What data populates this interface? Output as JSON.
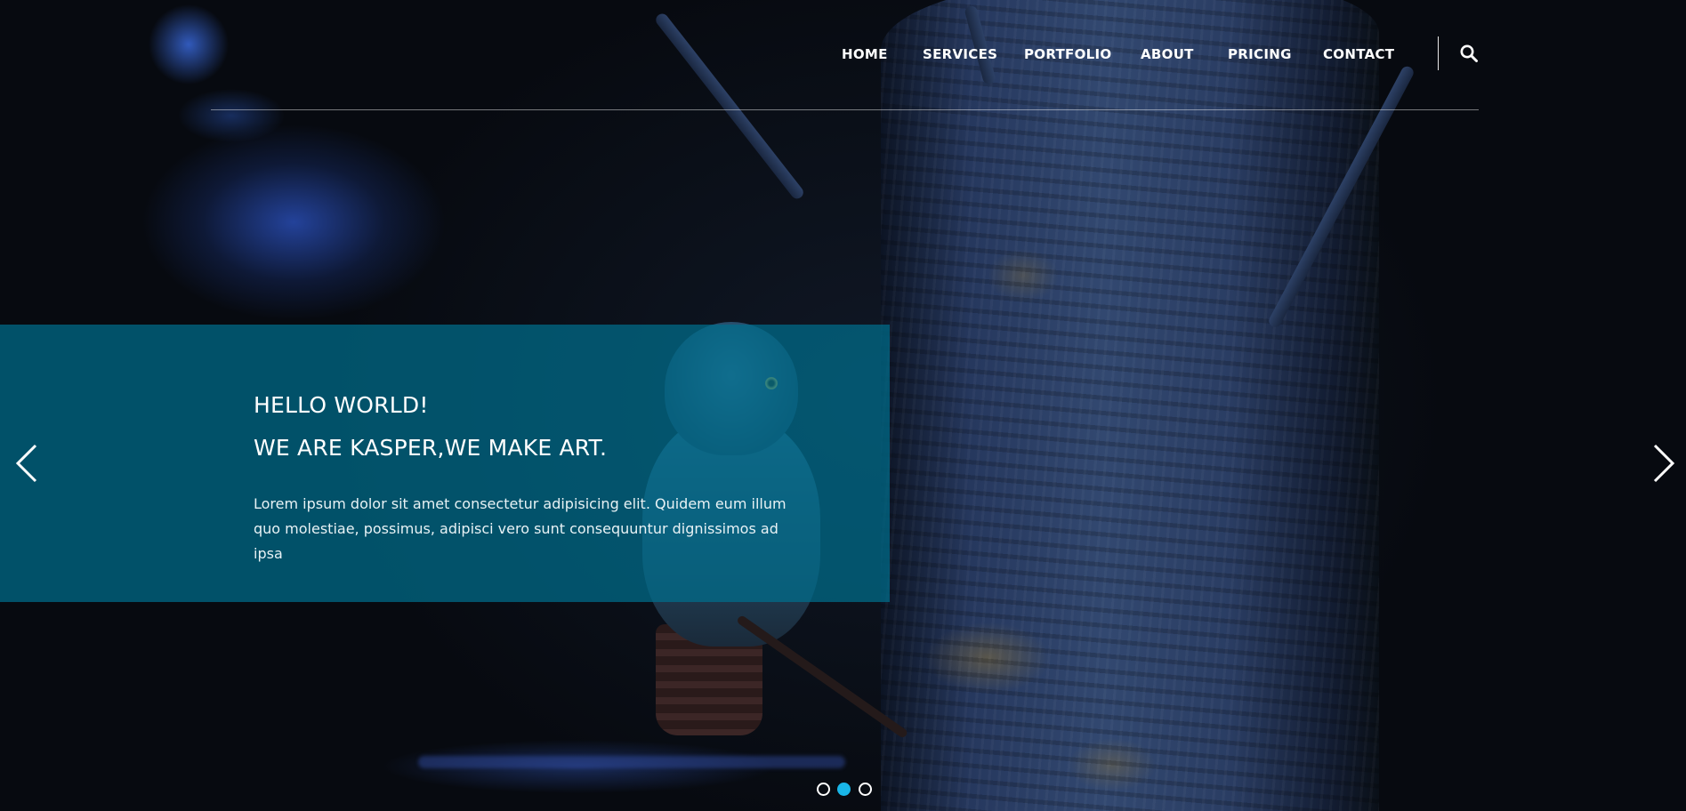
{
  "nav": {
    "items": [
      {
        "label": "HOME"
      },
      {
        "label": "SERVICES"
      },
      {
        "label": "PORTFOLIO"
      },
      {
        "label": "ABOUT"
      },
      {
        "label": "PRICING"
      },
      {
        "label": "CONTACT"
      }
    ],
    "search_icon": "search-icon"
  },
  "hero": {
    "heading_line1": "HELLO WORLD!",
    "heading_line2": "WE ARE KASPER,WE MAKE ART.",
    "description": "Lorem ipsum dolor sit amet consectetur adipisicing elit. Quidem eum illum quo molestiae, possimus, adipisci vero sunt consequuntur dignissimos ad ipsa",
    "prev_icon": "chevron-left-icon",
    "next_icon": "chevron-right-icon"
  },
  "slider": {
    "slide_count": 3,
    "active_slide": 2
  },
  "colors": {
    "panel": "#006e8c",
    "active_dot": "#19b6e8",
    "text": "#ffffff"
  }
}
